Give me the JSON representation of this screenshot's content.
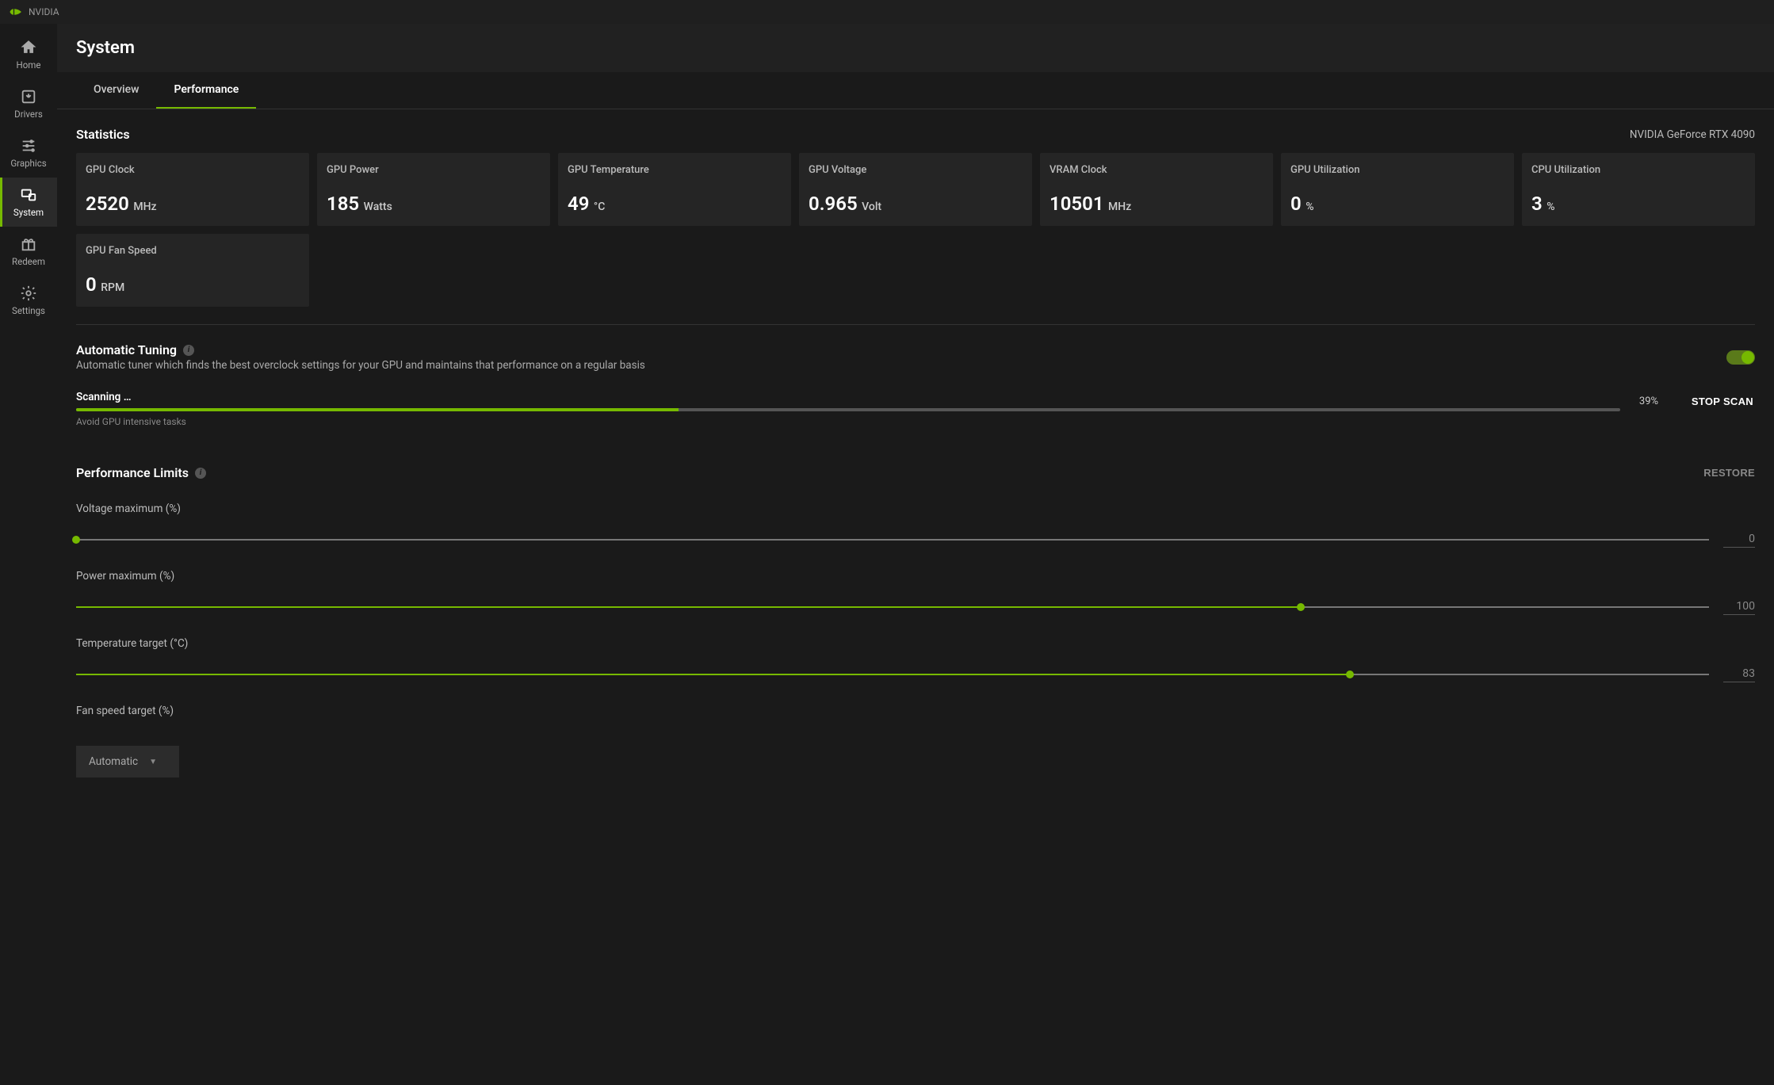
{
  "titlebar": {
    "brand": "NVIDIA"
  },
  "sidebar": {
    "items": [
      {
        "id": "home",
        "label": "Home"
      },
      {
        "id": "drivers",
        "label": "Drivers"
      },
      {
        "id": "graphics",
        "label": "Graphics"
      },
      {
        "id": "system",
        "label": "System"
      },
      {
        "id": "redeem",
        "label": "Redeem"
      },
      {
        "id": "settings",
        "label": "Settings"
      }
    ],
    "active": "system"
  },
  "page": {
    "title": "System",
    "tabs": [
      {
        "id": "overview",
        "label": "Overview"
      },
      {
        "id": "performance",
        "label": "Performance"
      }
    ],
    "active_tab": "performance"
  },
  "statistics": {
    "heading": "Statistics",
    "device": "NVIDIA GeForce RTX 4090",
    "cards": [
      {
        "label": "GPU Clock",
        "value": "2520",
        "unit": "MHz"
      },
      {
        "label": "GPU Power",
        "value": "185",
        "unit": "Watts"
      },
      {
        "label": "GPU Temperature",
        "value": "49",
        "unit": "°C"
      },
      {
        "label": "GPU Voltage",
        "value": "0.965",
        "unit": "Volt"
      },
      {
        "label": "VRAM Clock",
        "value": "10501",
        "unit": "MHz"
      },
      {
        "label": "GPU Utilization",
        "value": "0",
        "unit": "%"
      },
      {
        "label": "CPU Utilization",
        "value": "3",
        "unit": "%"
      },
      {
        "label": "GPU Fan Speed",
        "value": "0",
        "unit": "RPM"
      }
    ]
  },
  "tuning": {
    "heading": "Automatic Tuning",
    "description": "Automatic tuner which finds the best overclock settings for your GPU and maintains that performance on a regular basis",
    "toggle_on": true,
    "scan": {
      "status_label": "Scanning …",
      "progress_pct": 39,
      "progress_text": "39%",
      "stop_label": "STOP SCAN",
      "hint": "Avoid GPU intensive tasks"
    }
  },
  "limits": {
    "heading": "Performance Limits",
    "restore_label": "RESTORE",
    "sliders": [
      {
        "id": "voltage",
        "label": "Voltage maximum (%)",
        "value": 0,
        "display": "0",
        "fill_pct": 0
      },
      {
        "id": "power",
        "label": "Power maximum (%)",
        "value": 100,
        "display": "100",
        "fill_pct": 75
      },
      {
        "id": "temp",
        "label": "Temperature target (°C)",
        "value": 83,
        "display": "83",
        "fill_pct": 78
      }
    ],
    "fan": {
      "label": "Fan speed target (%)",
      "selected": "Automatic"
    }
  }
}
